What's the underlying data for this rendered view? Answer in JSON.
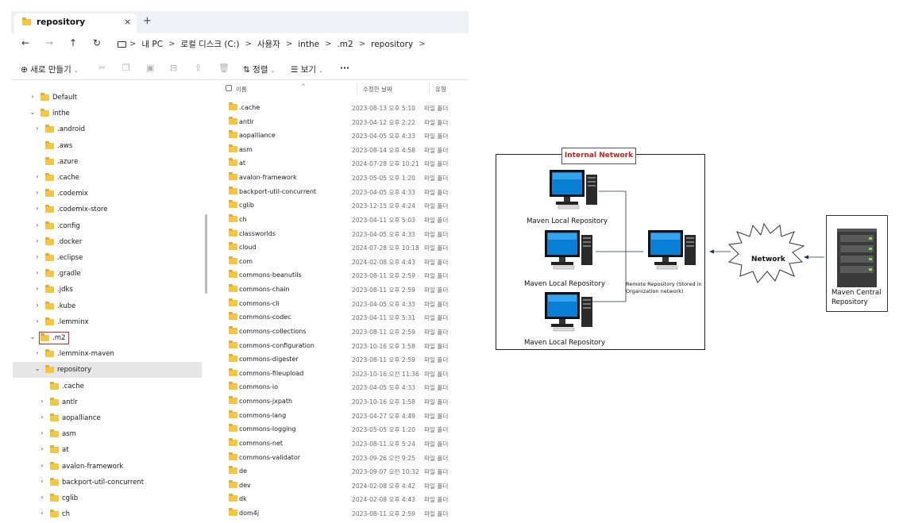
{
  "explorer": {
    "tab_title": "repository",
    "tab_close": "×",
    "new_tab": "+",
    "address": {
      "crumbs": [
        "내 PC",
        "로컬 디스크 (C:)",
        "사용자",
        "inthe",
        ".m2",
        "repository"
      ],
      "separator": ">"
    },
    "toolbar": {
      "new_label": "새로 만들기",
      "sort_label": "정렬",
      "view_label": "보기",
      "more_label": "···"
    },
    "tree": [
      {
        "label": "Default",
        "level": 1,
        "chevron": "›"
      },
      {
        "label": "inthe",
        "level": 1,
        "chevron": "⌄"
      },
      {
        "label": ".android",
        "level": 2,
        "chevron": "›"
      },
      {
        "label": ".aws",
        "level": 2,
        "chevron": ""
      },
      {
        "label": ".azure",
        "level": 2,
        "chevron": ""
      },
      {
        "label": ".cache",
        "level": 2,
        "chevron": "›"
      },
      {
        "label": ".codemix",
        "level": 2,
        "chevron": "›"
      },
      {
        "label": ".codemix-store",
        "level": 2,
        "chevron": "›"
      },
      {
        "label": ".config",
        "level": 2,
        "chevron": "›"
      },
      {
        "label": ".docker",
        "level": 2,
        "chevron": "›"
      },
      {
        "label": ".eclipse",
        "level": 2,
        "chevron": "›"
      },
      {
        "label": ".gradle",
        "level": 2,
        "chevron": "›"
      },
      {
        "label": ".jdks",
        "level": 2,
        "chevron": "›"
      },
      {
        "label": ".kube",
        "level": 2,
        "chevron": "›"
      },
      {
        "label": ".lemminx",
        "level": 2,
        "chevron": "›"
      },
      {
        "label": ".m2",
        "level": 1,
        "chevron": "⌄",
        "highlighted": true
      },
      {
        "label": ".lemminx-maven",
        "level": 2,
        "chevron": "›"
      },
      {
        "label": "repository",
        "level": 2,
        "chevron": "⌄",
        "selected": true
      },
      {
        "label": ".cache",
        "level": 3,
        "chevron": ""
      },
      {
        "label": "antlr",
        "level": 3,
        "chevron": "›"
      },
      {
        "label": "aopalliance",
        "level": 3,
        "chevron": "›"
      },
      {
        "label": "asm",
        "level": 3,
        "chevron": "›"
      },
      {
        "label": "at",
        "level": 3,
        "chevron": "›"
      },
      {
        "label": "avalon-framework",
        "level": 3,
        "chevron": "›"
      },
      {
        "label": "backport-util-concurrent",
        "level": 3,
        "chevron": "›"
      },
      {
        "label": "cglib",
        "level": 3,
        "chevron": "›"
      },
      {
        "label": "ch",
        "level": 3,
        "chevron": "›"
      }
    ],
    "list_header": {
      "name": "이름",
      "date": "수정한 날짜",
      "type": "유형"
    },
    "files": [
      {
        "name": ".cache",
        "date": "2023-08-13 오후 5:10",
        "type": "파일 폴더"
      },
      {
        "name": "antlr",
        "date": "2023-04-12 오후 2:22",
        "type": "파일 폴더"
      },
      {
        "name": "aopalliance",
        "date": "2023-04-05 오후 4:33",
        "type": "파일 폴더"
      },
      {
        "name": "asm",
        "date": "2023-08-14 오후 4:58",
        "type": "파일 폴더"
      },
      {
        "name": "at",
        "date": "2024-07-28 오후 10:21",
        "type": "파일 폴더"
      },
      {
        "name": "avalon-framework",
        "date": "2023-05-05 오후 1:20",
        "type": "파일 폴더"
      },
      {
        "name": "backport-util-concurrent",
        "date": "2023-04-05 오후 4:33",
        "type": "파일 폴더"
      },
      {
        "name": "cglib",
        "date": "2023-12-15 오후 4:24",
        "type": "파일 폴더"
      },
      {
        "name": "ch",
        "date": "2023-04-11 오후 5:03",
        "type": "파일 폴더"
      },
      {
        "name": "classworlds",
        "date": "2023-04-05 오후 4:33",
        "type": "파일 폴더"
      },
      {
        "name": "cloud",
        "date": "2024-07-28 오후 10:18",
        "type": "파일 폴더"
      },
      {
        "name": "com",
        "date": "2024-02-08 오후 4:43",
        "type": "파일 폴더"
      },
      {
        "name": "commons-beanutils",
        "date": "2023-08-11 오후 2:59",
        "type": "파일 폴더"
      },
      {
        "name": "commons-chain",
        "date": "2023-08-11 오후 2:59",
        "type": "파일 폴더"
      },
      {
        "name": "commons-cli",
        "date": "2023-04-05 오후 4:33",
        "type": "파일 폴더"
      },
      {
        "name": "commons-codec",
        "date": "2023-04-11 오후 5:31",
        "type": "파일 폴더"
      },
      {
        "name": "commons-collections",
        "date": "2023-08-11 오후 2:59",
        "type": "파일 폴더"
      },
      {
        "name": "commons-configuration",
        "date": "2023-10-16 오후 1:58",
        "type": "파일 폴더"
      },
      {
        "name": "commons-digester",
        "date": "2023-08-11 오후 2:59",
        "type": "파일 폴더"
      },
      {
        "name": "commons-fileupload",
        "date": "2023-10-16 오전 11:36",
        "type": "파일 폴더"
      },
      {
        "name": "commons-io",
        "date": "2023-04-05 오후 4:33",
        "type": "파일 폴더"
      },
      {
        "name": "commons-jxpath",
        "date": "2023-10-16 오후 1:58",
        "type": "파일 폴더"
      },
      {
        "name": "commons-lang",
        "date": "2023-04-27 오후 4:49",
        "type": "파일 폴더"
      },
      {
        "name": "commons-logging",
        "date": "2023-05-05 오후 1:20",
        "type": "파일 폴더"
      },
      {
        "name": "commons-net",
        "date": "2023-08-11 오후 5:24",
        "type": "파일 폴더"
      },
      {
        "name": "commons-validator",
        "date": "2023-09-26 오전 9:25",
        "type": "파일 폴더"
      },
      {
        "name": "de",
        "date": "2023-09-07 오전 10:32",
        "type": "파일 폴더"
      },
      {
        "name": "dev",
        "date": "2024-02-08 오후 4:42",
        "type": "파일 폴더"
      },
      {
        "name": "dk",
        "date": "2024-02-08 오후 4:43",
        "type": "파일 폴더"
      },
      {
        "name": "dom4j",
        "date": "2023-08-11 오후 2:59",
        "type": "파일 폴더"
      }
    ]
  },
  "diagram": {
    "internal_network_label": "Internal Network",
    "local_repo_1": "Maven Local Repository",
    "local_repo_2": "Maven Local Repository",
    "local_repo_3": "Maven Local Repository",
    "remote_repo_line1": "Remote Repository (Stored in",
    "remote_repo_line2": "Organization network)",
    "network_label": "Network",
    "central_line1": "Maven Central",
    "central_line2": "Repository"
  },
  "colors": {
    "folder": "#f3c643",
    "selection": "#e6e6e6",
    "highlight_box": "#d9262c",
    "internal_network_text": "#c0231d",
    "server_green": "#7ed957"
  },
  "icons": [
    "folder-icon",
    "back-arrow-icon",
    "forward-arrow-icon",
    "up-arrow-icon",
    "refresh-icon",
    "pc-icon",
    "cut-icon",
    "copy-icon",
    "paste-icon",
    "rename-icon",
    "share-icon",
    "delete-icon",
    "sort-icon",
    "view-icon",
    "computer-icon",
    "server-icon",
    "cloud-burst-icon"
  ]
}
